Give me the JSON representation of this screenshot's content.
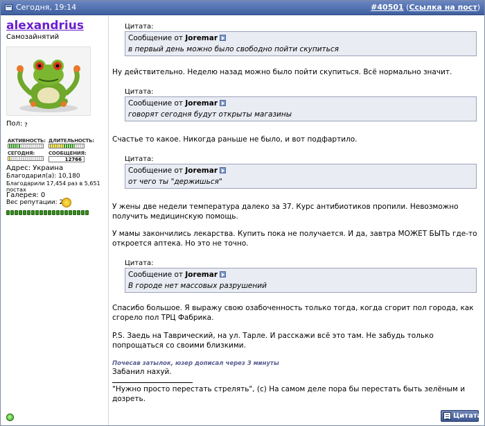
{
  "header": {
    "date": "Сегодня, 19:14",
    "post_number": "#40501",
    "link_label": "Ссылка на пост",
    "open_paren": "(",
    "close_paren": ")"
  },
  "user": {
    "name": "alexandrius",
    "title": "Самозайнятий",
    "gender_label": "Пол:",
    "gender_value": "?",
    "activity_label": "АКТИВНОСТЬ:",
    "activity_level": 0.33,
    "duration_label": "ДЛИТЕЛЬНОСТЬ:",
    "duration_level": 0.78,
    "today_label": "СЕГОДНЯ:",
    "today_level": 0.05,
    "messages_label": "СООБЩЕНИЯ:",
    "messages_count": "12766",
    "address": "Адрес: Украина",
    "thanked": "Благодарил(а): 10,180",
    "thanked_by": "Благодарили 17,454 раз в 5,651 постах",
    "gallery": "Галерея: 0",
    "reputation": "Вес репутации: 201",
    "reputation_level": 1.0
  },
  "post": {
    "quotes": [
      {
        "label": "Цитата:",
        "from": "Сообщение от",
        "author": "Joremar",
        "text": "в первый день можно было свободно пойти скупиться"
      },
      {
        "label": "Цитата:",
        "from": "Сообщение от",
        "author": "Joremar",
        "text": "говорят сегодня будут открыты магазины"
      },
      {
        "label": "Цитата:",
        "from": "Сообщение от",
        "author": "Joremar",
        "text": "от чего ты \"держишься\""
      },
      {
        "label": "Цитата:",
        "from": "Сообщение от",
        "author": "Joremar",
        "text": "В городе нет массовых разрушений"
      }
    ],
    "paragraphs": [
      "Ну действительно. Неделю назад можно было пойти скупиться. Всё нормально значит.",
      "Счастье то какое. Никогда раньше не было, и вот подфартило.",
      "У жены две недели температура далеко за 37. Курс антибиотиков пропили. Невозможно получить медицинскую помощь.",
      "У мамы закончились лекарства. Купить пока не получается. И да, завтра МОЖЕТ БЫТЬ где-то откроется аптека. Но это не точно.",
      "Спасибо большое. Я выражу свою озабоченность только тогда, когда сгорит пол города, как сгорело пол ТРЦ Фабрика.",
      "P.S. Заедь на Таврический, на ул. Тарле. И расскажи всё это там. Не забудь только попрощаться со своими близкими."
    ],
    "edit_note": "Почесав затылок, юзер дописал через 3 минуты",
    "edit_text": "Забанил нахуй.",
    "signature": "\"Нужно просто перестать стрелять\", (c) На самом деле пора бы перестать быть зелёным и дозреть.",
    "quote_button": "Цитата"
  }
}
